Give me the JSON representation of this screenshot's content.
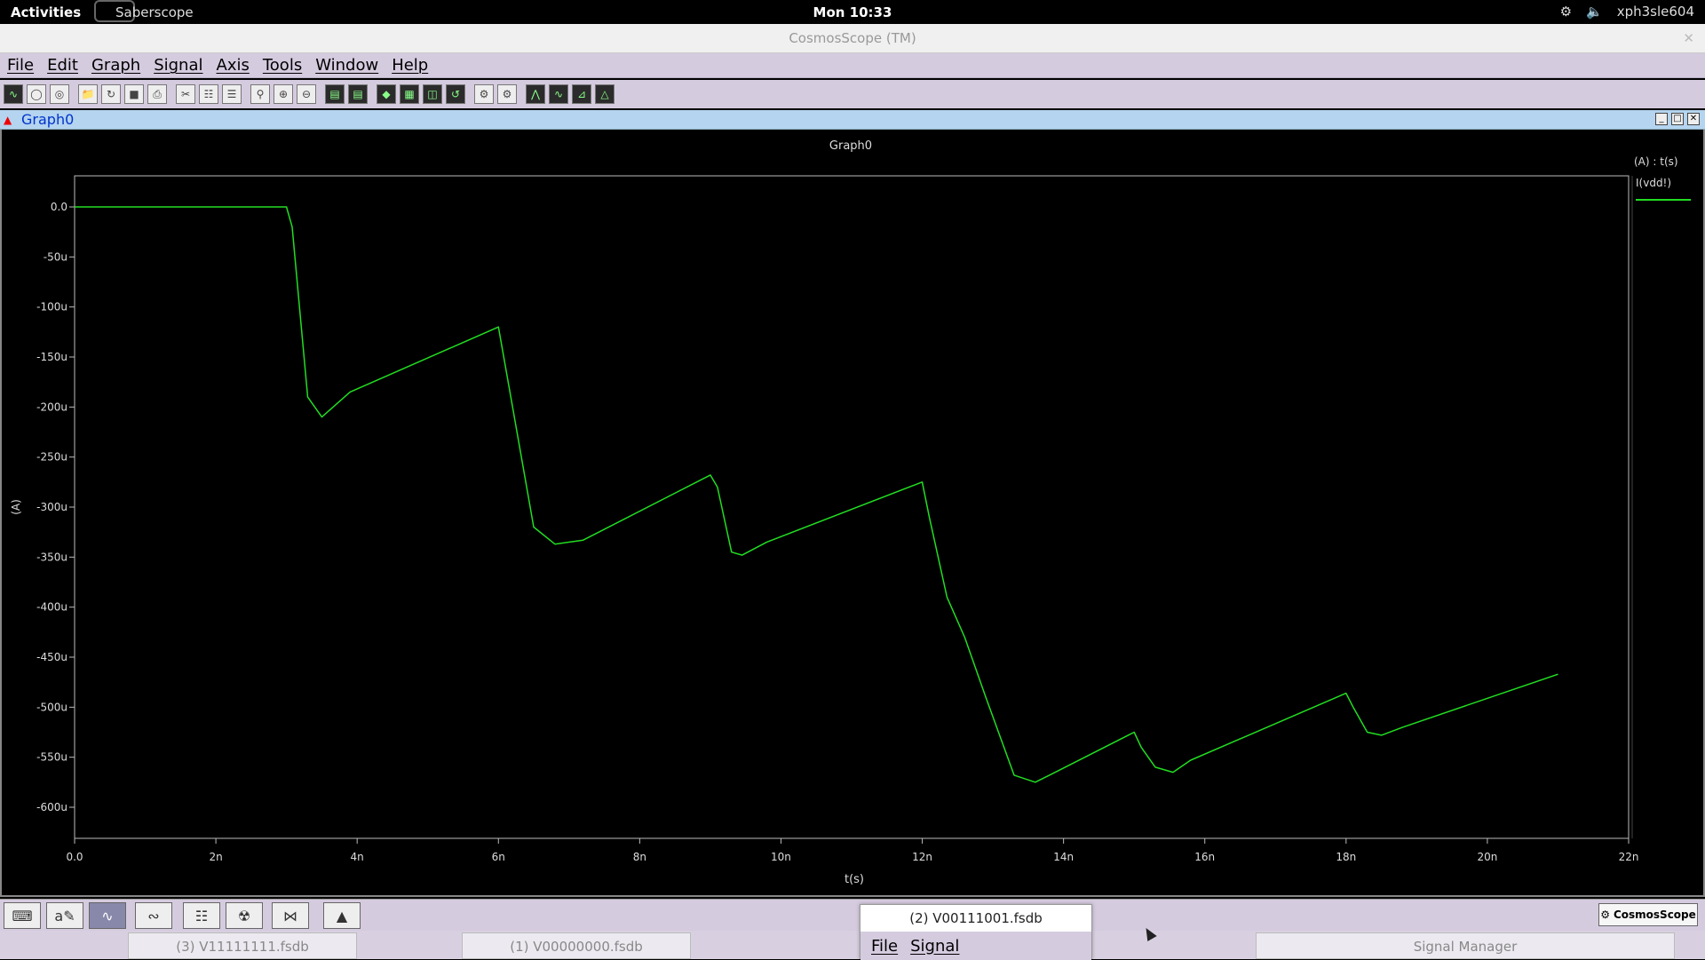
{
  "topbar": {
    "activities": "Activities",
    "app": "Saberscope",
    "clock": "Mon 10:33",
    "user": "xph3sle604"
  },
  "window": {
    "title": "CosmosScope (TM)",
    "close_icon": "close-icon"
  },
  "menu": [
    "File",
    "Edit",
    "Graph",
    "Signal",
    "Axis",
    "Tools",
    "Window",
    "Help"
  ],
  "graph": {
    "tab_title": "Graph0"
  },
  "chart_data": {
    "type": "line",
    "title": "Graph0",
    "xlabel": "t(s)",
    "ylabel": "(A)",
    "legend_header": "(A) : t(s)",
    "xlim": [
      0,
      22
    ],
    "ylim": [
      -600,
      0
    ],
    "x_ticks": [
      "0.0",
      "2n",
      "4n",
      "6n",
      "8n",
      "10n",
      "12n",
      "14n",
      "16n",
      "18n",
      "20n",
      "22n"
    ],
    "y_ticks": [
      "0.0",
      "-50u",
      "-100u",
      "-150u",
      "-200u",
      "-250u",
      "-300u",
      "-350u",
      "-400u",
      "-450u",
      "-500u",
      "-550u",
      "-600u"
    ],
    "grid": false,
    "legend_position": "right",
    "series": [
      {
        "name": "I(vdd!)",
        "color": "#22dd22",
        "x": [
          0,
          3.0,
          3.08,
          3.3,
          3.5,
          3.9,
          6.0,
          6.2,
          6.5,
          6.8,
          7.2,
          9.0,
          9.1,
          9.3,
          9.45,
          9.8,
          12.0,
          12.1,
          12.35,
          12.6,
          12.9,
          13.3,
          13.6,
          13.8,
          15.0,
          15.1,
          15.3,
          15.55,
          15.8,
          18.0,
          18.1,
          18.3,
          18.5,
          18.8,
          21.0
        ],
        "y": [
          0,
          0,
          -20,
          -190,
          -210,
          -185,
          -120,
          -200,
          -320,
          -337,
          -333,
          -268,
          -280,
          -345,
          -348,
          -335,
          -275,
          -310,
          -390,
          -430,
          -490,
          -568,
          -575,
          -568,
          -525,
          -540,
          -560,
          -565,
          -553,
          -486,
          -500,
          -525,
          -528,
          -520,
          -467
        ]
      }
    ]
  },
  "bottom_toolbar": {
    "brand": "CosmosScope"
  },
  "taskbar": {
    "tasks": [
      "(3) V11111111.fsdb",
      "(1) V00000000.fsdb",
      "Signal Manager"
    ]
  },
  "popup": {
    "title": "(2) V00111001.fsdb",
    "menu": [
      "File",
      "Signal"
    ]
  }
}
